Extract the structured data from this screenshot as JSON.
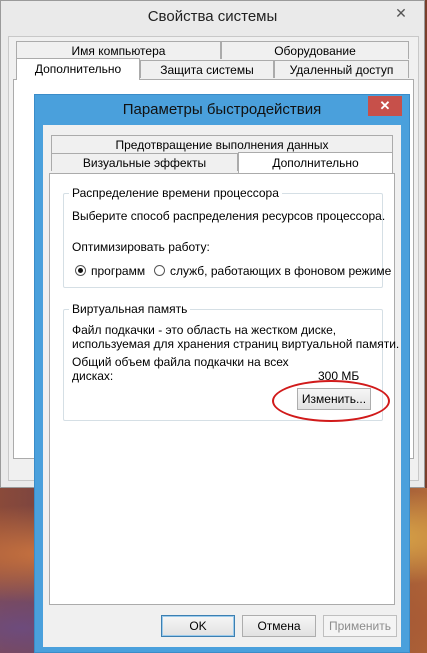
{
  "back_window": {
    "title": "Свойства системы",
    "close_glyph": "✕",
    "tabs_row1": [
      "Имя компьютера",
      "Оборудование"
    ],
    "tabs_row2": [
      "Дополнительно",
      "Защита системы",
      "Удаленный доступ"
    ]
  },
  "dialog": {
    "title": "Параметры быстродействия",
    "close_glyph": "✕",
    "tabs_row1": [
      "Предотвращение выполнения данных"
    ],
    "tabs_row2": [
      "Визуальные эффекты",
      "Дополнительно"
    ],
    "cpu_group": {
      "legend": "Распределение времени процессора",
      "description": "Выберите способ распределения ресурсов процессора.",
      "optimize_label": "Оптимизировать работу:",
      "options": [
        {
          "label": "программ",
          "checked": true
        },
        {
          "label": "служб, работающих в фоновом режиме",
          "checked": false
        }
      ]
    },
    "vm_group": {
      "legend": "Виртуальная память",
      "desc_line1": "Файл подкачки - это область на жестком диске,",
      "desc_line2": "используемая для хранения страниц виртуальной памяти.",
      "total_label_line1": "Общий объем файла подкачки на всех",
      "total_label_line2": "дисках:",
      "total_value": "300 МБ",
      "change_button": "Изменить..."
    },
    "buttons": {
      "ok": "OK",
      "cancel": "Отмена",
      "apply": "Применить"
    }
  },
  "colors": {
    "accent_title_bar": "#4aa0dc",
    "close_button": "#c7504a",
    "highlight_oval": "#d11a1a"
  }
}
